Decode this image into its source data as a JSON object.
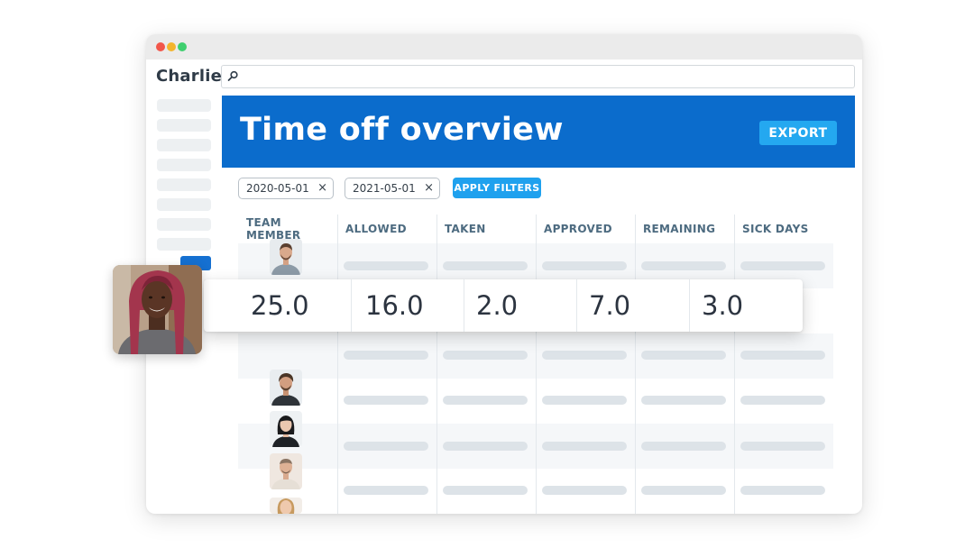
{
  "app": {
    "brand": "Charlie"
  },
  "search": {
    "placeholder": ""
  },
  "hero": {
    "title": "Time off overview",
    "export_label": "EXPORT"
  },
  "filters": {
    "start_date": "2020-05-01",
    "end_date": "2021-05-01",
    "clear_symbol": "×",
    "apply_label": "APPLY FILTERS"
  },
  "table": {
    "columns": [
      "TEAM MEMBER",
      "ALLOWED",
      "TAKEN",
      "APPROVED",
      "REMAINING",
      "SICK DAYS"
    ]
  },
  "highlighted_row": {
    "values": [
      "25.0",
      "16.0",
      "2.0",
      "7.0",
      "3.0"
    ]
  },
  "colors": {
    "brand_blue": "#0b6ccc",
    "accent_blue": "#1fa1ee",
    "header_text": "#4d6b80"
  },
  "icons": [
    "search-icon",
    "close-icon"
  ]
}
